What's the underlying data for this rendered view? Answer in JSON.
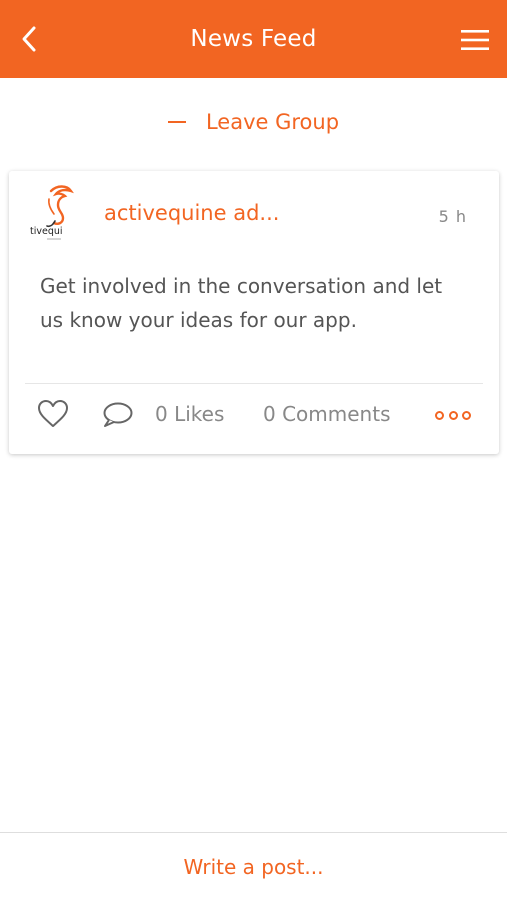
{
  "header": {
    "title": "News Feed",
    "back_icon": "chevron-left-icon",
    "menu_icon": "hamburger-menu-icon"
  },
  "group": {
    "leave_label": "Leave Group"
  },
  "post": {
    "author": "activequine ad...",
    "avatar_logo_text": "tivequi",
    "timestamp": "5 h",
    "text": "Get involved in the conversation and let us know your ideas for our app.",
    "likes_label": "0 Likes",
    "comments_label": "0 Comments"
  },
  "composer": {
    "placeholder": "Write a post..."
  },
  "colors": {
    "accent": "#f26522",
    "muted_text": "#888888",
    "body_text": "#555555"
  }
}
